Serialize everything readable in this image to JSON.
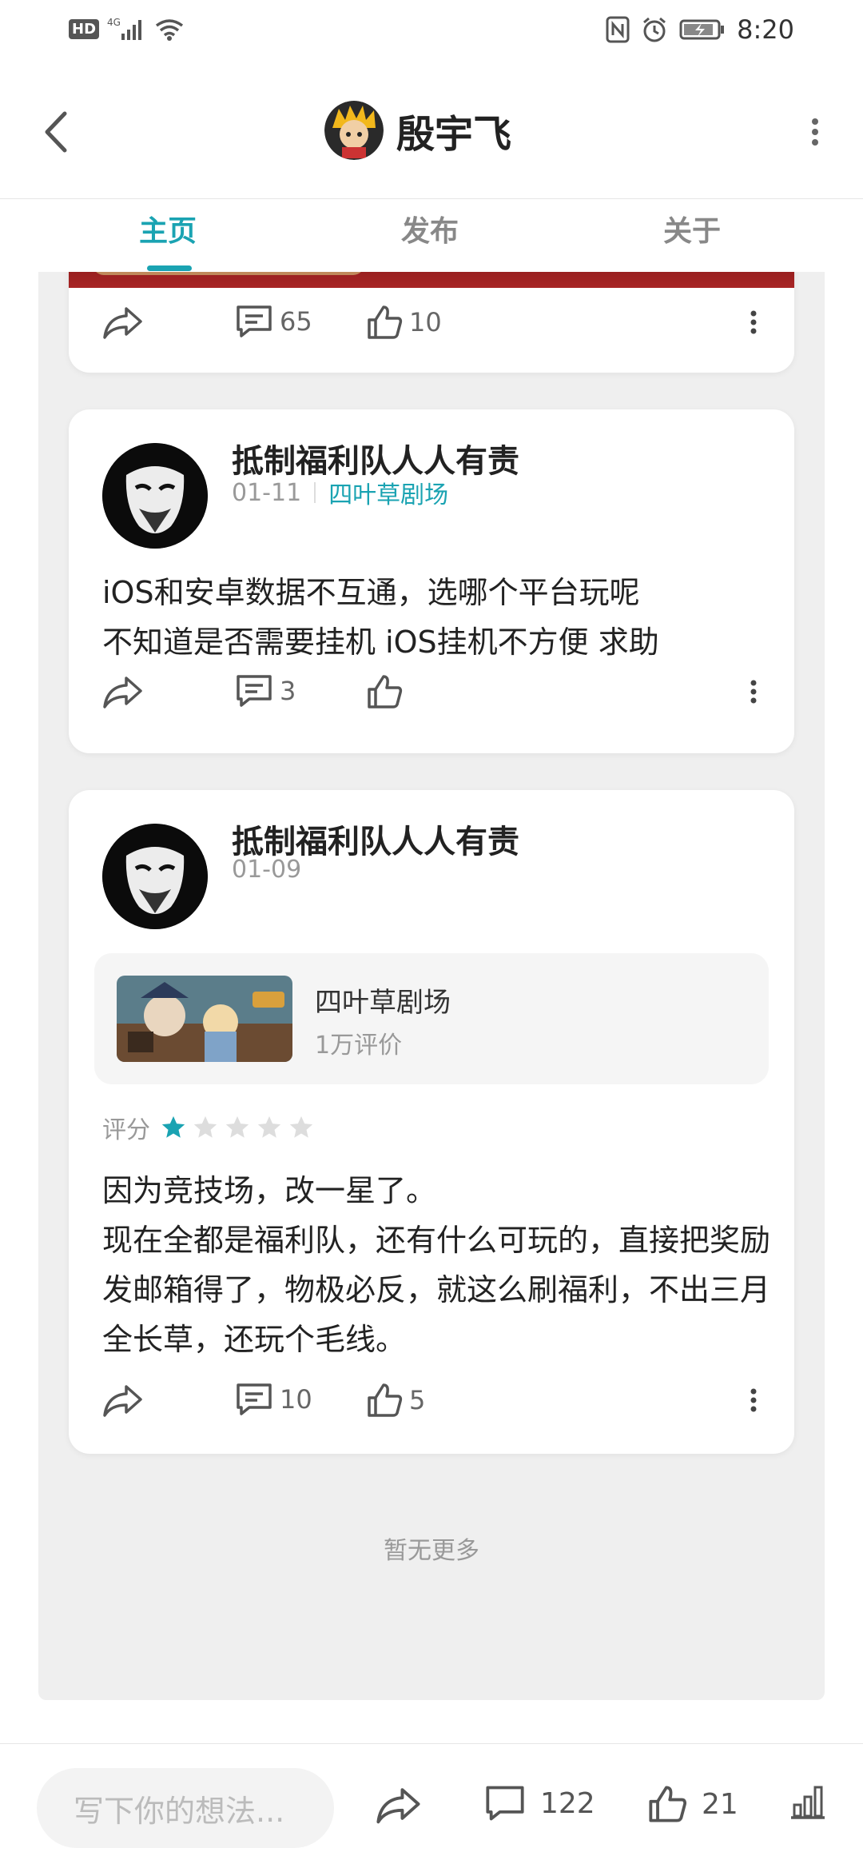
{
  "status_bar": {
    "hd": "HD",
    "network": "4G",
    "time": "8:20"
  },
  "header": {
    "title": "殷宇飞"
  },
  "tabs": [
    {
      "label": "主页",
      "active": true
    },
    {
      "label": "发布",
      "active": false
    },
    {
      "label": "关于",
      "active": false
    }
  ],
  "posts": [
    {
      "comments": "65",
      "likes": "10"
    },
    {
      "author": "抵制福利队人人有责",
      "date": "01-11",
      "game_tag": "四叶草剧场",
      "text": "iOS和安卓数据不互通，选哪个平台玩呢\n不知道是否需要挂机 iOS挂机不方便 求助",
      "comments": "3",
      "likes": ""
    },
    {
      "author": "抵制福利队人人有责",
      "date": "01-09",
      "game": {
        "name": "四叶草剧场",
        "reviews": "1万评价"
      },
      "rating_label": "评分",
      "rating": 1,
      "rating_max": 5,
      "text": "因为竞技场，改一星了。\n现在全都是福利队，还有什么可玩的，直接把奖励发邮箱得了，物极必反，就这么刷福利，不出三月全长草，还玩个毛线。",
      "comments": "10",
      "likes": "5"
    }
  ],
  "feed_end_text": "暂无更多",
  "bottom_bar": {
    "input_placeholder": "写下你的想法...",
    "comments": "122",
    "likes": "21"
  },
  "colors": {
    "accent": "#1aa3b2",
    "feed_bg": "#efefef",
    "star_empty": "#dddddd"
  }
}
